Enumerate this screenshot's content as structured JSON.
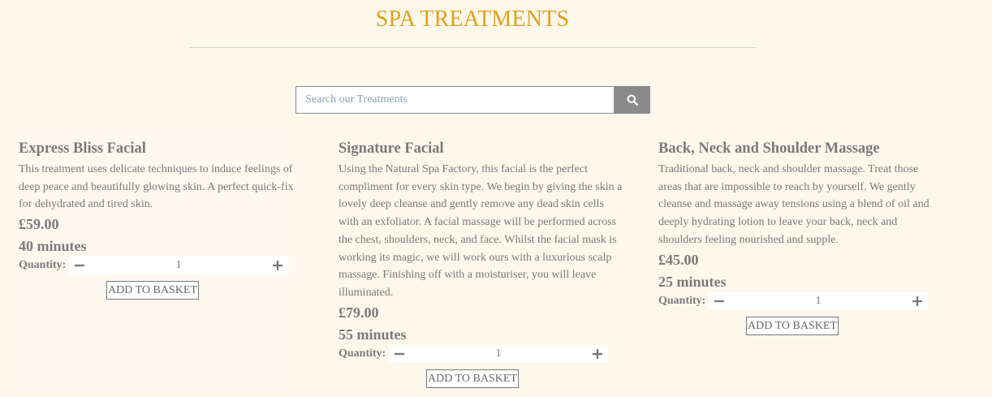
{
  "header": {
    "title": "SPA TREATMENTS"
  },
  "search": {
    "placeholder": "Search our Treatments",
    "value": "",
    "button_icon": "search-icon"
  },
  "colors": {
    "title": "#e0a21a",
    "background": "#fdf8ec",
    "text": "#7a7a7a",
    "search_button": "#8a8a8a"
  },
  "treatments": [
    {
      "name": "Express Bliss Facial",
      "description": "This treatment uses delicate techniques to induce feelings of deep peace and beautifully glowing skin. A perfect quick-fix for dehydrated and tired skin.",
      "price": "£59.00",
      "duration": "40 minutes",
      "quantity_label": "Quantity:",
      "quantity": "1",
      "button_label": "ADD TO BASKET"
    },
    {
      "name": "Signature Facial",
      "description": "Using the Natural Spa Factory, this facial is the perfect compliment for every skin type. We begin by giving the skin a lovely deep cleanse and gently remove any dead skin cells with an exfoliator. A facial massage will be performed across the chest, shoulders, neck, and face. Whilst the facial mask is working its magic, we will work ours with a luxurious scalp massage. Finishing off with a moisturiser, you will leave illuminated.",
      "price": "£79.00",
      "duration": "55 minutes",
      "quantity_label": "Quantity:",
      "quantity": "1",
      "button_label": "ADD TO BASKET"
    },
    {
      "name": "Back, Neck and Shoulder Massage",
      "description": "Traditional back, neck and shoulder massage. Treat those areas that are impossible to reach by yourself. We gently cleanse and massage away tensions using a blend of oil and deeply hydrating lotion to leave your back, neck and shoulders feeling nourished and supple.",
      "price": "£45.00",
      "duration": "25 minutes",
      "quantity_label": "Quantity:",
      "quantity": "1",
      "button_label": "ADD TO BASKET"
    }
  ]
}
